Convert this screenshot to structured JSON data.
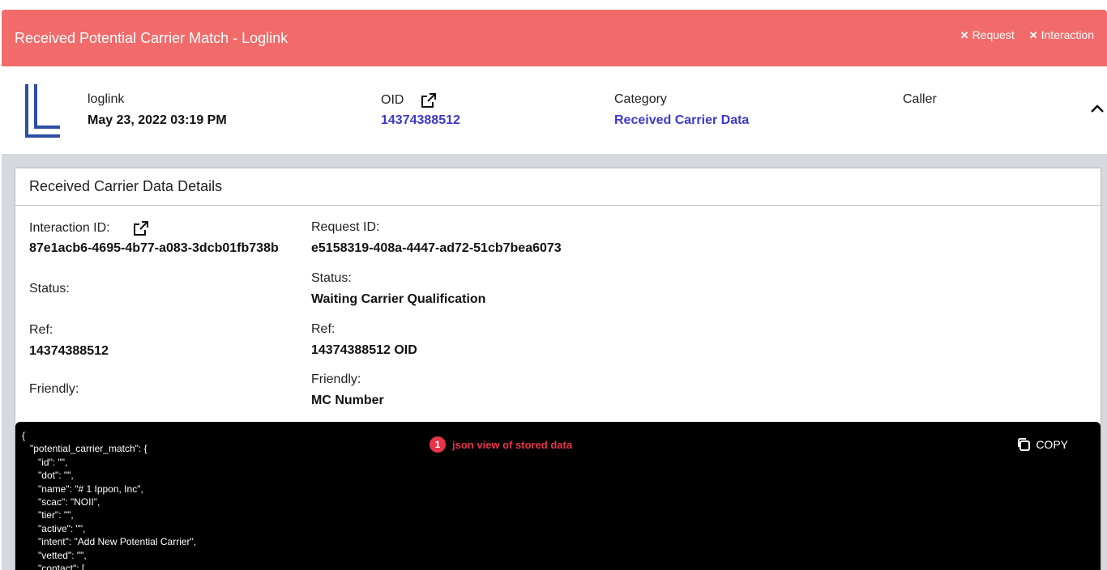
{
  "banner": {
    "title": "Received Potential Carrier Match - Loglink",
    "request_label": "Request",
    "interaction_label": "Interaction",
    "color": "#f26b6b"
  },
  "summary": {
    "source_label": "loglink",
    "datetime": "May 23, 2022 03:19 PM",
    "oid_label": "OID",
    "oid_value": "14374388512",
    "category_label": "Category",
    "category_value": "Received Carrier Data",
    "caller_label": "Caller",
    "link_color": "#3f38c8",
    "logo_icon": "loglink-logo-icon"
  },
  "details": {
    "title": "Received Carrier Data Details",
    "left": {
      "interaction_id_label": "Interaction ID:",
      "interaction_id_value": "87e1acb6-4695-4b77-a083-3dcb01fb738b",
      "status_label": "Status:",
      "ref_label": "Ref:",
      "ref_value": "14374388512",
      "friendly_label": "Friendly:"
    },
    "right": {
      "request_id_label": "Request ID:",
      "request_id_value": "e5158319-408a-4447-ad72-51cb7bea6073",
      "status_label": "Status:",
      "status_value": "Waiting Carrier Qualification",
      "ref_label": "Ref:",
      "ref_value": "14374388512 OID",
      "friendly_label": "Friendly:",
      "friendly_value": "MC Number"
    }
  },
  "json_view": {
    "text": "{\n   \"potential_carrier_match\": {\n      \"id\": \"\",\n      \"dot\": \"\",\n      \"name\": \"# 1 Ippon, Inc\",\n      \"scac\": \"NOII\",\n      \"tier\": \"\",\n      \"active\": \"\",\n      \"intent\": \"Add New Potential Carrier\",\n      \"vetted\": \"\",\n      \"contact\": [",
    "annotation_number": "1",
    "annotation_text": "json view of stored data",
    "copy_label": "COPY",
    "annotation_color": "#e8354a"
  }
}
